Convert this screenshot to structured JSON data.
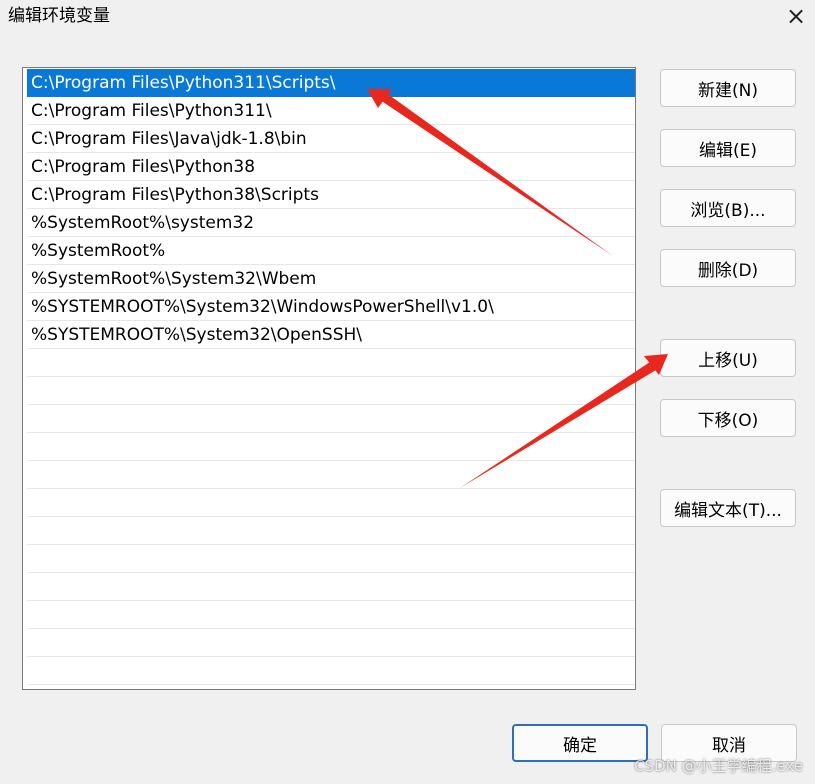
{
  "window": {
    "title": "编辑环境变量",
    "close_icon": "×"
  },
  "path_list": {
    "selected_index": 0,
    "items": [
      "C:\\Program Files\\Python311\\Scripts\\",
      "C:\\Program Files\\Python311\\",
      "C:\\Program Files\\Java\\jdk-1.8\\bin",
      "C:\\Program Files\\Python38",
      "C:\\Program Files\\Python38\\Scripts",
      "%SystemRoot%\\system32",
      "%SystemRoot%",
      "%SystemRoot%\\System32\\Wbem",
      "%SYSTEMROOT%\\System32\\WindowsPowerShell\\v1.0\\",
      "%SYSTEMROOT%\\System32\\OpenSSH\\"
    ]
  },
  "buttons": {
    "new": "新建(N)",
    "edit": "编辑(E)",
    "browse": "浏览(B)...",
    "delete": "删除(D)",
    "move_up": "上移(U)",
    "move_down": "下移(O)",
    "edit_text": "编辑文本(T)...",
    "ok": "确定",
    "cancel": "取消"
  },
  "watermark": "CSDN @小王学编程.exe",
  "colors": {
    "selection": "#0a78d7",
    "annotation_arrow": "#e8281e",
    "ok_border": "#2d6fb8"
  }
}
